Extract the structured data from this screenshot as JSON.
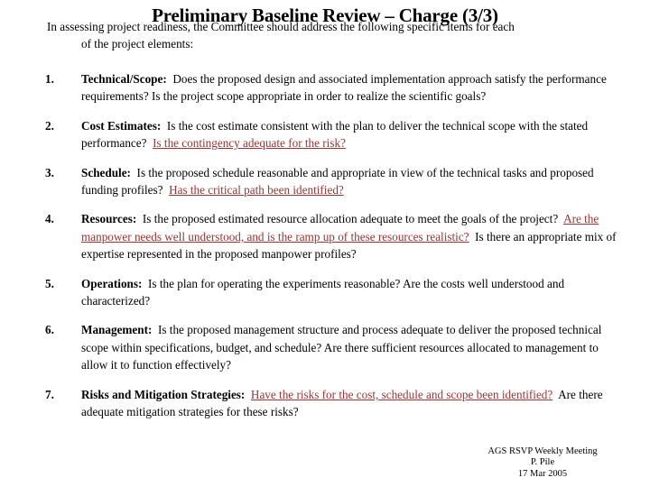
{
  "slide": {
    "title": "Preliminary Baseline Review – Charge (3/3)",
    "intro_line1": "In assessing project readiness, the Committee should address the following specific items for each",
    "intro_line2": "of the project elements:"
  },
  "items": [
    {
      "number": "1.",
      "label": "Technical/Scope:",
      "body_before": "Does the proposed design and associated implementation approach satisfy the performance requirements?  Is the project scope appropriate in order to realize the scientific goals?",
      "emphasis": "",
      "body_after": ""
    },
    {
      "number": "2.",
      "label": "Cost Estimates:",
      "body_before": "Is the cost estimate consistent with the plan to deliver the technical scope with the stated performance?",
      "emphasis": "Is the contingency adequate for the risk?",
      "body_after": ""
    },
    {
      "number": "3.",
      "label": "Schedule:",
      "body_before": "Is the proposed schedule reasonable and appropriate in view of the technical tasks and proposed funding profiles?",
      "emphasis": "Has the critical path been identified?",
      "body_after": ""
    },
    {
      "number": "4.",
      "label": "Resources:",
      "body_before": "Is the proposed estimated resource allocation adequate to meet the goals of the project?",
      "emphasis": "Are the manpower needs well understood, and is the ramp up of these resources realistic?",
      "body_after": "Is there an appropriate mix of expertise represented in the proposed manpower profiles?"
    },
    {
      "number": "5.",
      "label": "Operations:",
      "body_before": "Is the plan for operating the experiments reasonable?  Are the costs well understood and characterized?",
      "emphasis": "",
      "body_after": ""
    },
    {
      "number": "6.",
      "label": "Management:",
      "body_before": "Is the proposed management structure and process adequate to deliver the proposed technical scope within specifications, budget, and schedule?  Are there sufficient resources allocated to management to allow it to function effectively?",
      "emphasis": "",
      "body_after": ""
    },
    {
      "number": "7.",
      "label": "Risks and Mitigation Strategies:",
      "body_before": "",
      "emphasis": "Have the risks for the cost, schedule and scope been identified?",
      "body_after": "Are there adequate mitigation strategies for these risks?"
    }
  ],
  "footer": {
    "line1": "AGS RSVP Weekly Meeting",
    "line2": "P. Pile",
    "line3": "17 Mar 2005"
  },
  "colors": {
    "emphasis_red": "#993333",
    "text": "#000000",
    "background": "#ffffff"
  }
}
